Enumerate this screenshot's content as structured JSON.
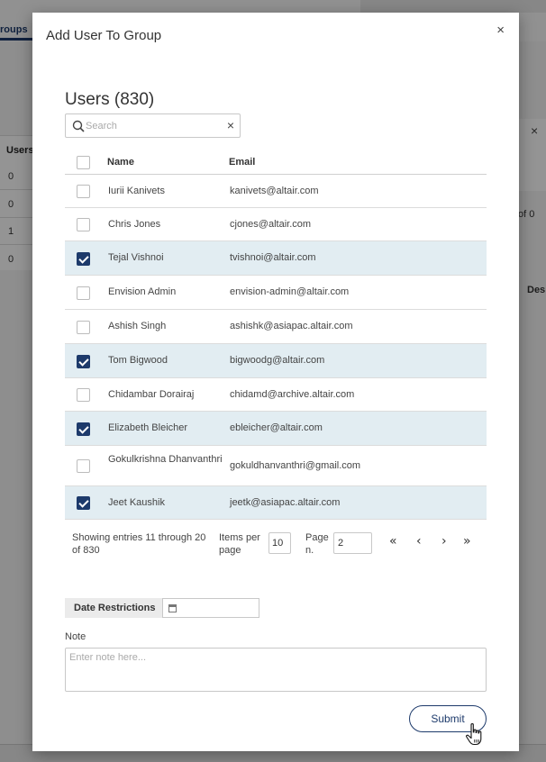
{
  "background": {
    "tab_label": "roups",
    "column_header": "Users",
    "values": [
      "0",
      "0",
      "1",
      "0"
    ],
    "right_close": "×",
    "right_of_text": "of 0",
    "right_heading": "Des"
  },
  "modal": {
    "title": "Add User To Group",
    "close_glyph": "×"
  },
  "users": {
    "heading": "Users (830)",
    "search_placeholder": "Search",
    "search_clear_glyph": "×",
    "columns": {
      "name": "Name",
      "email": "Email"
    },
    "rows": [
      {
        "name": "Iurii Kanivets",
        "email": "kanivets@altair.com",
        "checked": false
      },
      {
        "name": "Chris Jones",
        "email": "cjones@altair.com",
        "checked": false
      },
      {
        "name": "Tejal Vishnoi",
        "email": "tvishnoi@altair.com",
        "checked": true
      },
      {
        "name": "Envision Admin",
        "email": "envision-admin@altair.com",
        "checked": false
      },
      {
        "name": "Ashish Singh",
        "email": "ashishk@asiapac.altair.com",
        "checked": false
      },
      {
        "name": "Tom Bigwood",
        "email": "bigwoodg@altair.com",
        "checked": true
      },
      {
        "name": "Chidambar Dorairaj",
        "email": "chidamd@archive.altair.com",
        "checked": false
      },
      {
        "name": "Elizabeth Bleicher",
        "email": "ebleicher@altair.com",
        "checked": true
      },
      {
        "name": "Gokulkrishna Dhanvanthri",
        "email": "gokuldhanvanthri@gmail.com",
        "checked": false
      },
      {
        "name": "Jeet Kaushik",
        "email": "jeetk@asiapac.altair.com",
        "checked": true
      }
    ]
  },
  "pagination": {
    "info": "Showing entries 11 through 20 of 830",
    "items_per_page_label": "Items per page",
    "items_per_page_value": "10",
    "page_label": "Page n.",
    "page_value": "2",
    "first": "«",
    "prev": "‹",
    "next": "›",
    "last": "»"
  },
  "date_restrictions": {
    "label": "Date Restrictions",
    "value": ""
  },
  "note": {
    "label": "Note",
    "placeholder": "Enter note here..."
  },
  "submit_label": "Submit",
  "colors": {
    "accent": "#1d3a6b",
    "selected_row": "#e2edf2"
  },
  "icons": {
    "search": "search-icon",
    "calendar": "calendar-icon",
    "cursor": "hand-pointer-icon"
  }
}
